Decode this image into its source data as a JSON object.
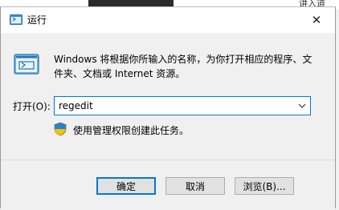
{
  "background": {
    "text": "讲入道"
  },
  "titlebar": {
    "title": "运行",
    "close_glyph": "✕"
  },
  "dialog": {
    "description": "Windows 将根据你所输入的名称，为你打开相应的程序、文件夹、文档或 Internet 资源。",
    "open_label": "打开(O):",
    "input_value": "regedit",
    "admin_note": "使用管理权限创建此任务。"
  },
  "buttons": {
    "ok": "确定",
    "cancel": "取消",
    "browse": "浏览(B)..."
  },
  "colors": {
    "accent": "#0078d7",
    "button_face": "#e1e1e1",
    "window_bg": "#f0f0f0"
  }
}
